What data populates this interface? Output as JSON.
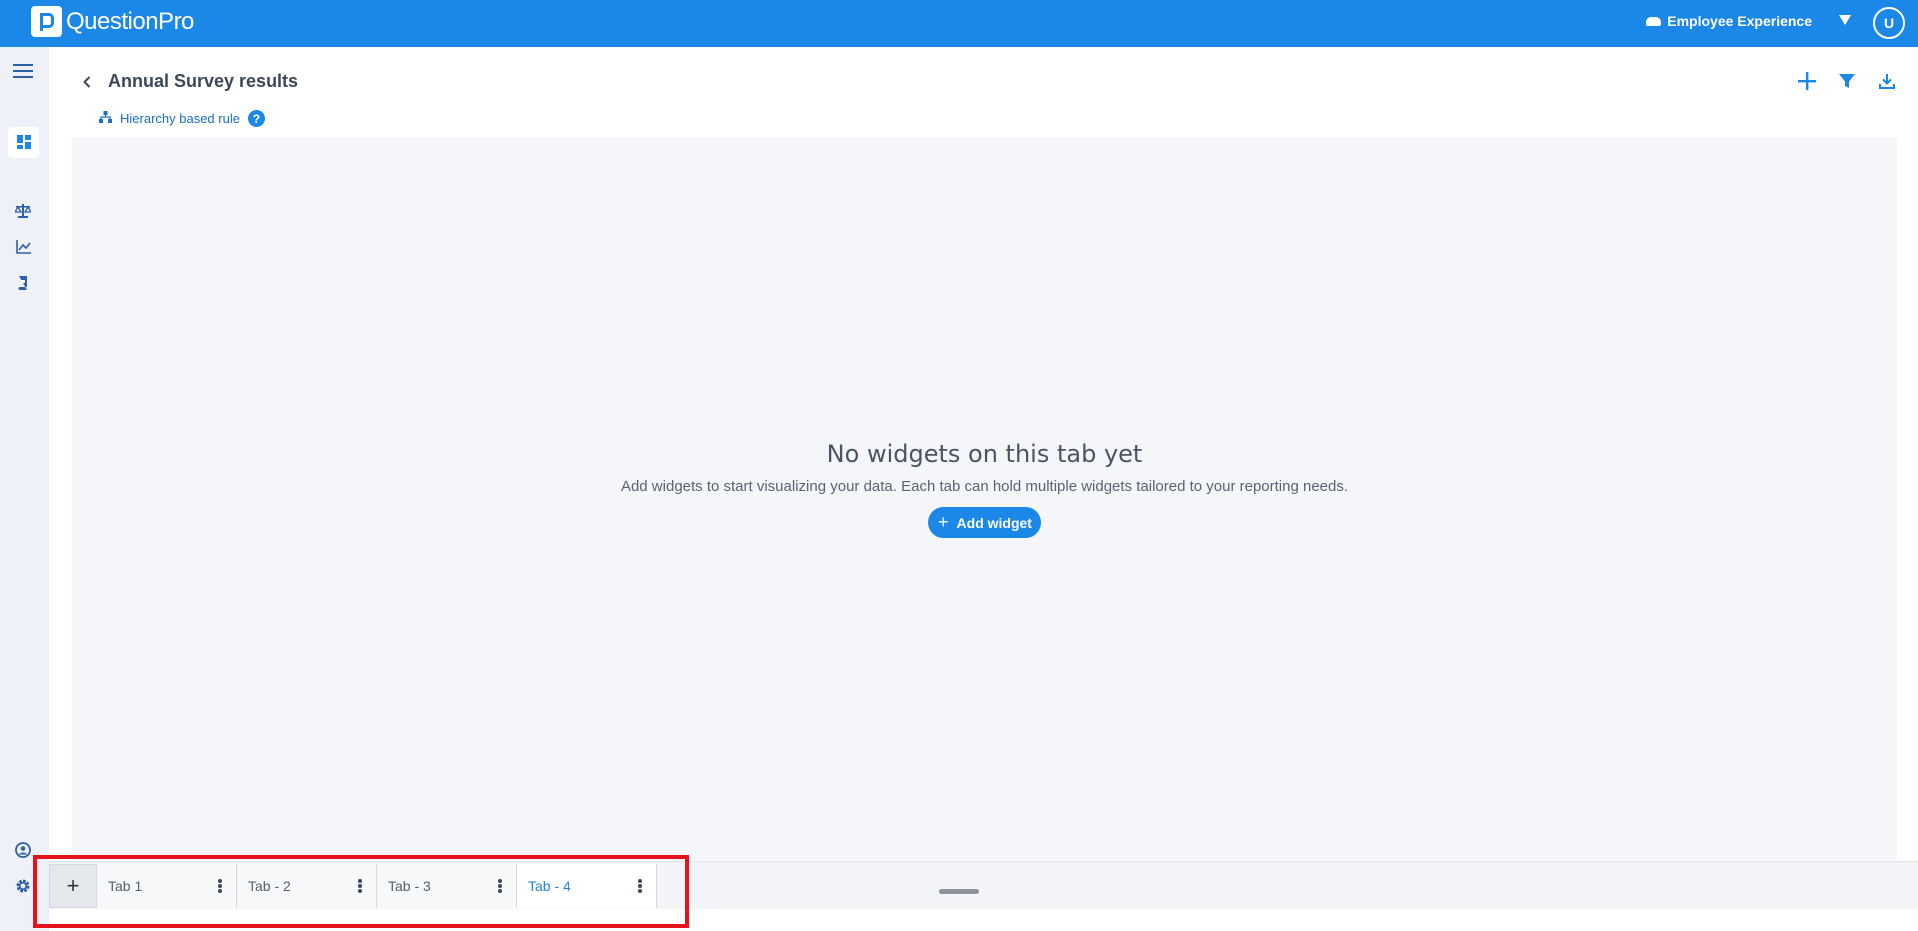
{
  "brand": {
    "name": "QuestionPro"
  },
  "topbar": {
    "product_label": "Employee Experience",
    "avatar_initial": "U"
  },
  "header": {
    "title": "Annual Survey results",
    "hierarchy_rule_label": "Hierarchy based rule",
    "help_glyph": "?"
  },
  "empty_state": {
    "title": "No widgets on this tab yet",
    "subtitle": "Add widgets to start visualizing your data. Each tab can hold multiple widgets tailored to your reporting needs.",
    "button_label": "Add widget",
    "button_plus": "+"
  },
  "tabs": {
    "add_label": "+",
    "items": [
      {
        "label": "Tab 1",
        "active": false
      },
      {
        "label": "Tab - 2",
        "active": false
      },
      {
        "label": "Tab - 3",
        "active": false
      },
      {
        "label": "Tab - 4",
        "active": true
      }
    ]
  },
  "colors": {
    "brand_blue": "#1b87e6",
    "highlight_red": "#e3121b",
    "canvas_bg": "#f4f6f9"
  },
  "icons": [
    "hamburger-menu-icon",
    "dashboard-icon",
    "scale-icon",
    "line-chart-icon",
    "report-icon",
    "user-circle-icon",
    "gear-icon",
    "back-chevron-icon",
    "hierarchy-icon",
    "help-icon",
    "plus-icon",
    "filter-icon",
    "download-icon",
    "cloud-icon",
    "caret-down-icon"
  ]
}
